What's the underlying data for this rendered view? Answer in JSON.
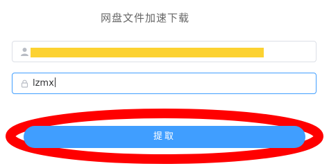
{
  "header": {
    "title": "网盘文件加速下载"
  },
  "form": {
    "user_field": {
      "icon": "user-icon",
      "highlight_color": "#fcd232"
    },
    "code_field": {
      "icon": "lock-icon",
      "value": "lzmx"
    },
    "submit_label": "提取"
  },
  "annotation": {
    "shape": "ellipse",
    "color": "#ff0000"
  },
  "colors": {
    "accent": "#409eff",
    "text": "#666666"
  }
}
